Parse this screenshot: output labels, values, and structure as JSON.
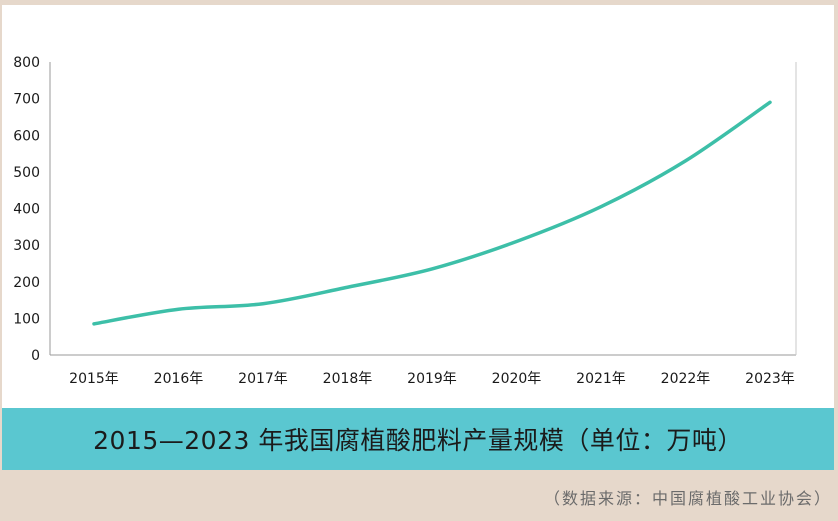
{
  "chart_data": {
    "type": "line",
    "title": "2015—2023 年我国腐植酸肥料产量规模（单位：万吨）",
    "source": "（数据来源：中国腐植酸工业协会）",
    "x": [
      "2015年",
      "2016年",
      "2017年",
      "2018年",
      "2019年",
      "2020年",
      "2021年",
      "2022年",
      "2023年"
    ],
    "series": [
      {
        "values": [
          85,
          125,
          140,
          185,
          235,
          310,
          405,
          530,
          690
        ]
      }
    ],
    "yticks": [
      0,
      100,
      200,
      300,
      400,
      500,
      600,
      700,
      800
    ],
    "ylim": [
      0,
      800
    ],
    "grid": false,
    "colors": {
      "line": "#3dbfa8",
      "band": "#5ac7d0",
      "background": "#e6d8cb"
    }
  }
}
